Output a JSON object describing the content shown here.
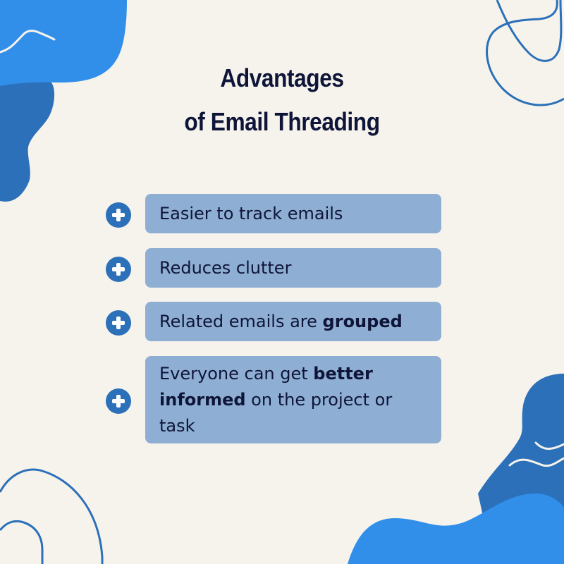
{
  "title": {
    "line1": "Advantages",
    "line2": "of Email Threading"
  },
  "items": [
    {
      "icon": "plus-circle-icon",
      "parts": [
        {
          "text": "Easier to track emails",
          "bold": false
        }
      ]
    },
    {
      "icon": "plus-circle-icon",
      "parts": [
        {
          "text": "Reduces clutter",
          "bold": false
        }
      ]
    },
    {
      "icon": "plus-circle-icon",
      "parts": [
        {
          "text": "Related emails are ",
          "bold": false
        },
        {
          "text": "grouped",
          "bold": true
        }
      ]
    },
    {
      "icon": "plus-circle-icon",
      "parts": [
        {
          "text": "Everyone can get ",
          "bold": false
        },
        {
          "text": "better informed",
          "bold": true
        },
        {
          "text": " on the project or task",
          "bold": false
        }
      ]
    }
  ],
  "colors": {
    "background": "#f6f3ed",
    "blob_light": "#318fea",
    "blob_dark": "#2b70b8",
    "item_bg": "#8eafd3",
    "text_dark": "#0f1538"
  }
}
